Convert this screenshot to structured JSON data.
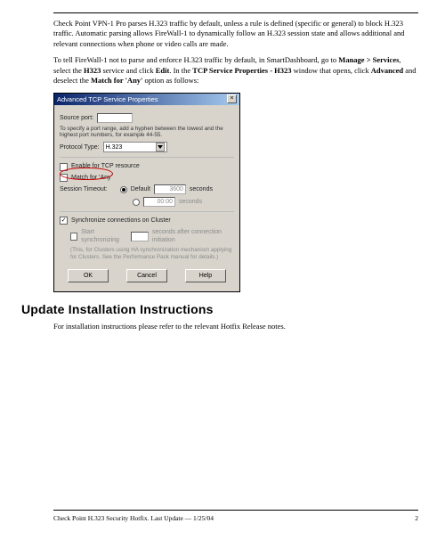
{
  "body": {
    "p1_prefix": "Check Point VPN-1 Pro parses H.323 traffic by default, unless a rule is defined (specific or general) to block H.323 traffic. Automatic parsing allows FireWall-1 to dynamically follow an H.323 session state and allows additional and relevant connections when phone or video calls are made.",
    "p2_a": "To tell FireWall-1 not to parse and enforce H.323 traffic by default, in SmartDashboard, go to ",
    "p2_b": "Manage > Services",
    "p2_c": ", select the ",
    "p2_d": "H323",
    "p2_e": " service and click ",
    "p2_f": "Edit",
    "p2_g": ". In the ",
    "p2_h": "TCP Service Properties - H323",
    "p2_i": " window that opens, click ",
    "p2_j": "Advanced",
    "p2_k": " and deselect the ",
    "p2_l": "Match for 'Any'",
    "p2_m": " option as follows:"
  },
  "dialog": {
    "title": "Advanced TCP Service Properties",
    "close_glyph": "×",
    "source_port_label": "Source port:",
    "source_port_value": "",
    "range_hint": "To specify a port range, add a hyphen between the lowest and the highest port numbers, for example 44-55.",
    "protocol_type_label": "Protocol Type:",
    "protocol_type_value": "H.323",
    "enable_tcp_label": "Enable for TCP resource",
    "match_any_label": "Match for 'Any'",
    "session_timeout_label": "Session Timeout:",
    "timeout_mode": "Default",
    "timeout_value": "3600",
    "timeout_unit": "seconds",
    "timeout_alt_value": "00:00",
    "sync_label": "Synchronize connections on Cluster",
    "delayed_sync_label": "Start synchronizing",
    "delayed_sync_value": "",
    "delayed_sync_suffix": "seconds after connection initiation",
    "delayed_note": "(This, for Clusters using HA synchronization mechanism applying for Clusters. See the Performance Pack manual for details.)",
    "buttons": {
      "ok": "OK",
      "cancel": "Cancel",
      "help": "Help"
    },
    "check_mark": "✓"
  },
  "section_heading": "Update Installation Instructions",
  "install_text": "For installation instructions please refer to the relevant Hotfix Release notes.",
  "footer": {
    "left": "Check Point H.323 Security Hotfix.    Last Update — 1/25/04",
    "right": "2"
  }
}
